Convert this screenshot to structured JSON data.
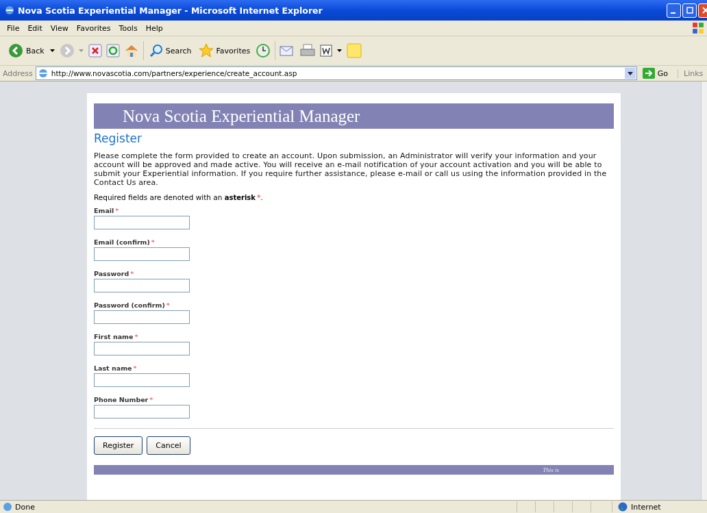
{
  "window": {
    "title": "Nova Scotia Experiential Manager - Microsoft Internet Explorer"
  },
  "menu": [
    "File",
    "Edit",
    "View",
    "Favorites",
    "Tools",
    "Help"
  ],
  "toolbar": {
    "back": "Back",
    "search": "Search",
    "favorites": "Favorites"
  },
  "address": {
    "label": "Address",
    "url": "http://www.novascotia.com/partners/experience/create_account.asp",
    "go": "Go",
    "links": "Links"
  },
  "page": {
    "banner": "Nova Scotia Experiential Manager",
    "heading": "Register",
    "intro": "Please complete the form provided to create an account. Upon submission, an Administrator will verify your information and your account will be approved and made active. You will receive an e-mail notification of your account activation and you will be able to submit your Experiential information. If you require further assistance, please e-mail or call us using the information provided in the Contact Us area.",
    "required_note": {
      "text": "Required fields are denoted with an **asterisk**",
      "mark": "*",
      "end": "."
    },
    "fields": [
      {
        "label": "Email",
        "mark": "*"
      },
      {
        "label": "Email (confirm)",
        "mark": "*"
      },
      {
        "label": "Password",
        "mark": "*"
      },
      {
        "label": "Password (confirm)",
        "mark": "*"
      },
      {
        "label": "First name",
        "mark": "*"
      },
      {
        "label": "Last name",
        "mark": "*"
      },
      {
        "label": "Phone Number",
        "mark": "*"
      }
    ],
    "buttons": [
      "Register",
      "Cancel"
    ],
    "footer": "This is"
  },
  "status_bar": {
    "text": "Done",
    "zone": "Internet"
  }
}
